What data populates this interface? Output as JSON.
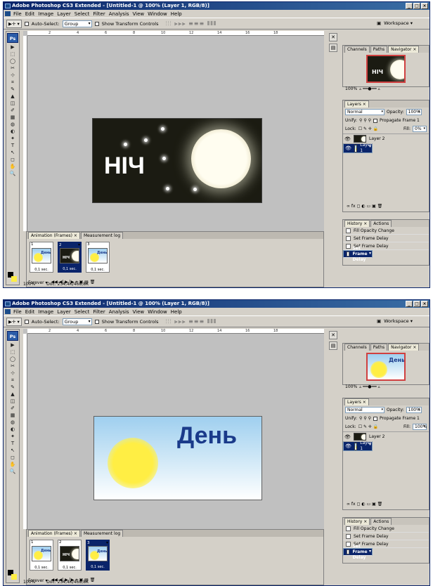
{
  "app": {
    "title": "Adobe Photoshop CS3 Extended - [Untitled-1 @ 100% (Layer 1, RGB/8)]",
    "menu": [
      "File",
      "Edit",
      "Image",
      "Layer",
      "Select",
      "Filter",
      "Analysis",
      "View",
      "Window",
      "Help"
    ],
    "options": {
      "auto_select": "Auto-Select:",
      "auto_select_value": "Group",
      "show_transform": "Show Transform Controls",
      "workspace": "Workspace ▾"
    },
    "ps_badge": "Ps"
  },
  "ruler_ticks": [
    "2",
    "4",
    "6",
    "8",
    "10",
    "12",
    "14",
    "16",
    "18"
  ],
  "screens": [
    {
      "canvas_text": "НІЧ",
      "anim_tabs": [
        "Animation (Frames) ×",
        "Measurement log"
      ],
      "frames": [
        {
          "num": "1",
          "delay": "0,1 sec.",
          "label": "День",
          "kind": "day"
        },
        {
          "num": "2",
          "delay": "0,1 sec.",
          "label": "НІЧ",
          "kind": "night",
          "selected": true
        },
        {
          "num": "3",
          "delay": "0,1 sec.",
          "label": "День",
          "kind": "day"
        }
      ],
      "loop": "Forever ▾",
      "zoom": "100%",
      "doc": "Doc: 234,4K/468,8K",
      "panels": {
        "nav_tabs": [
          "Channels",
          "Paths",
          "Navigator ×"
        ],
        "nav_zoom": "100%",
        "nav_thumb_label": "НІЧ",
        "nav_kind": "night",
        "layers_tab": "Layers ×",
        "blend": "Normal",
        "opacity_label": "Opacity:",
        "opacity": "100%",
        "unify": "Unify:",
        "propagate": "Propagate Frame 1",
        "lock": "Lock:",
        "fill_label": "Fill:",
        "fill": "0%",
        "layers": [
          {
            "name": "Layer 2",
            "kind": "night"
          },
          {
            "name": "Layer 1",
            "kind": "day",
            "selected": true
          }
        ],
        "history_tabs": [
          "History ×",
          "Actions"
        ],
        "history": [
          "Fill Opacity Change",
          "Set Frame Delay",
          "Set Frame Delay",
          "Set Frame Delay"
        ]
      }
    },
    {
      "canvas_text": "День",
      "anim_tabs": [
        "Animation (Frames) ×",
        "Measurement log"
      ],
      "frames": [
        {
          "num": "1",
          "delay": "0,1 sec.",
          "label": "День",
          "kind": "day"
        },
        {
          "num": "2",
          "delay": "0,1 sec.",
          "label": "НІЧ",
          "kind": "night"
        },
        {
          "num": "3",
          "delay": "0,1 sec.",
          "label": "День",
          "kind": "day",
          "selected": true
        }
      ],
      "loop": "Forever ▾",
      "zoom": "100%",
      "doc": "Doc: 234,4K/468,8K",
      "panels": {
        "nav_tabs": [
          "Channels",
          "Paths",
          "Navigator ×"
        ],
        "nav_zoom": "100%",
        "nav_thumb_label": "День",
        "nav_kind": "day",
        "layers_tab": "Layers ×",
        "blend": "Normal",
        "opacity_label": "Opacity:",
        "opacity": "100%",
        "unify": "Unify:",
        "propagate": "Propagate Frame 1",
        "lock": "Lock:",
        "fill_label": "Fill:",
        "fill": "100%",
        "layers": [
          {
            "name": "Layer 2",
            "kind": "night"
          },
          {
            "name": "Layer 1",
            "kind": "day",
            "selected": true
          }
        ],
        "history_tabs": [
          "History ×",
          "Actions"
        ],
        "history": [
          "Fill Opacity Change",
          "Set Frame Delay",
          "Set Frame Delay",
          "Set Frame Delay"
        ]
      }
    }
  ],
  "colors": {
    "night_bg": "#1b1b12",
    "sky_top": "#9fcfef",
    "sky_bottom": "#ffffff",
    "sun": "#ffee44",
    "title_blue": "#1a3a8a",
    "select_blue": "#0a246a"
  }
}
